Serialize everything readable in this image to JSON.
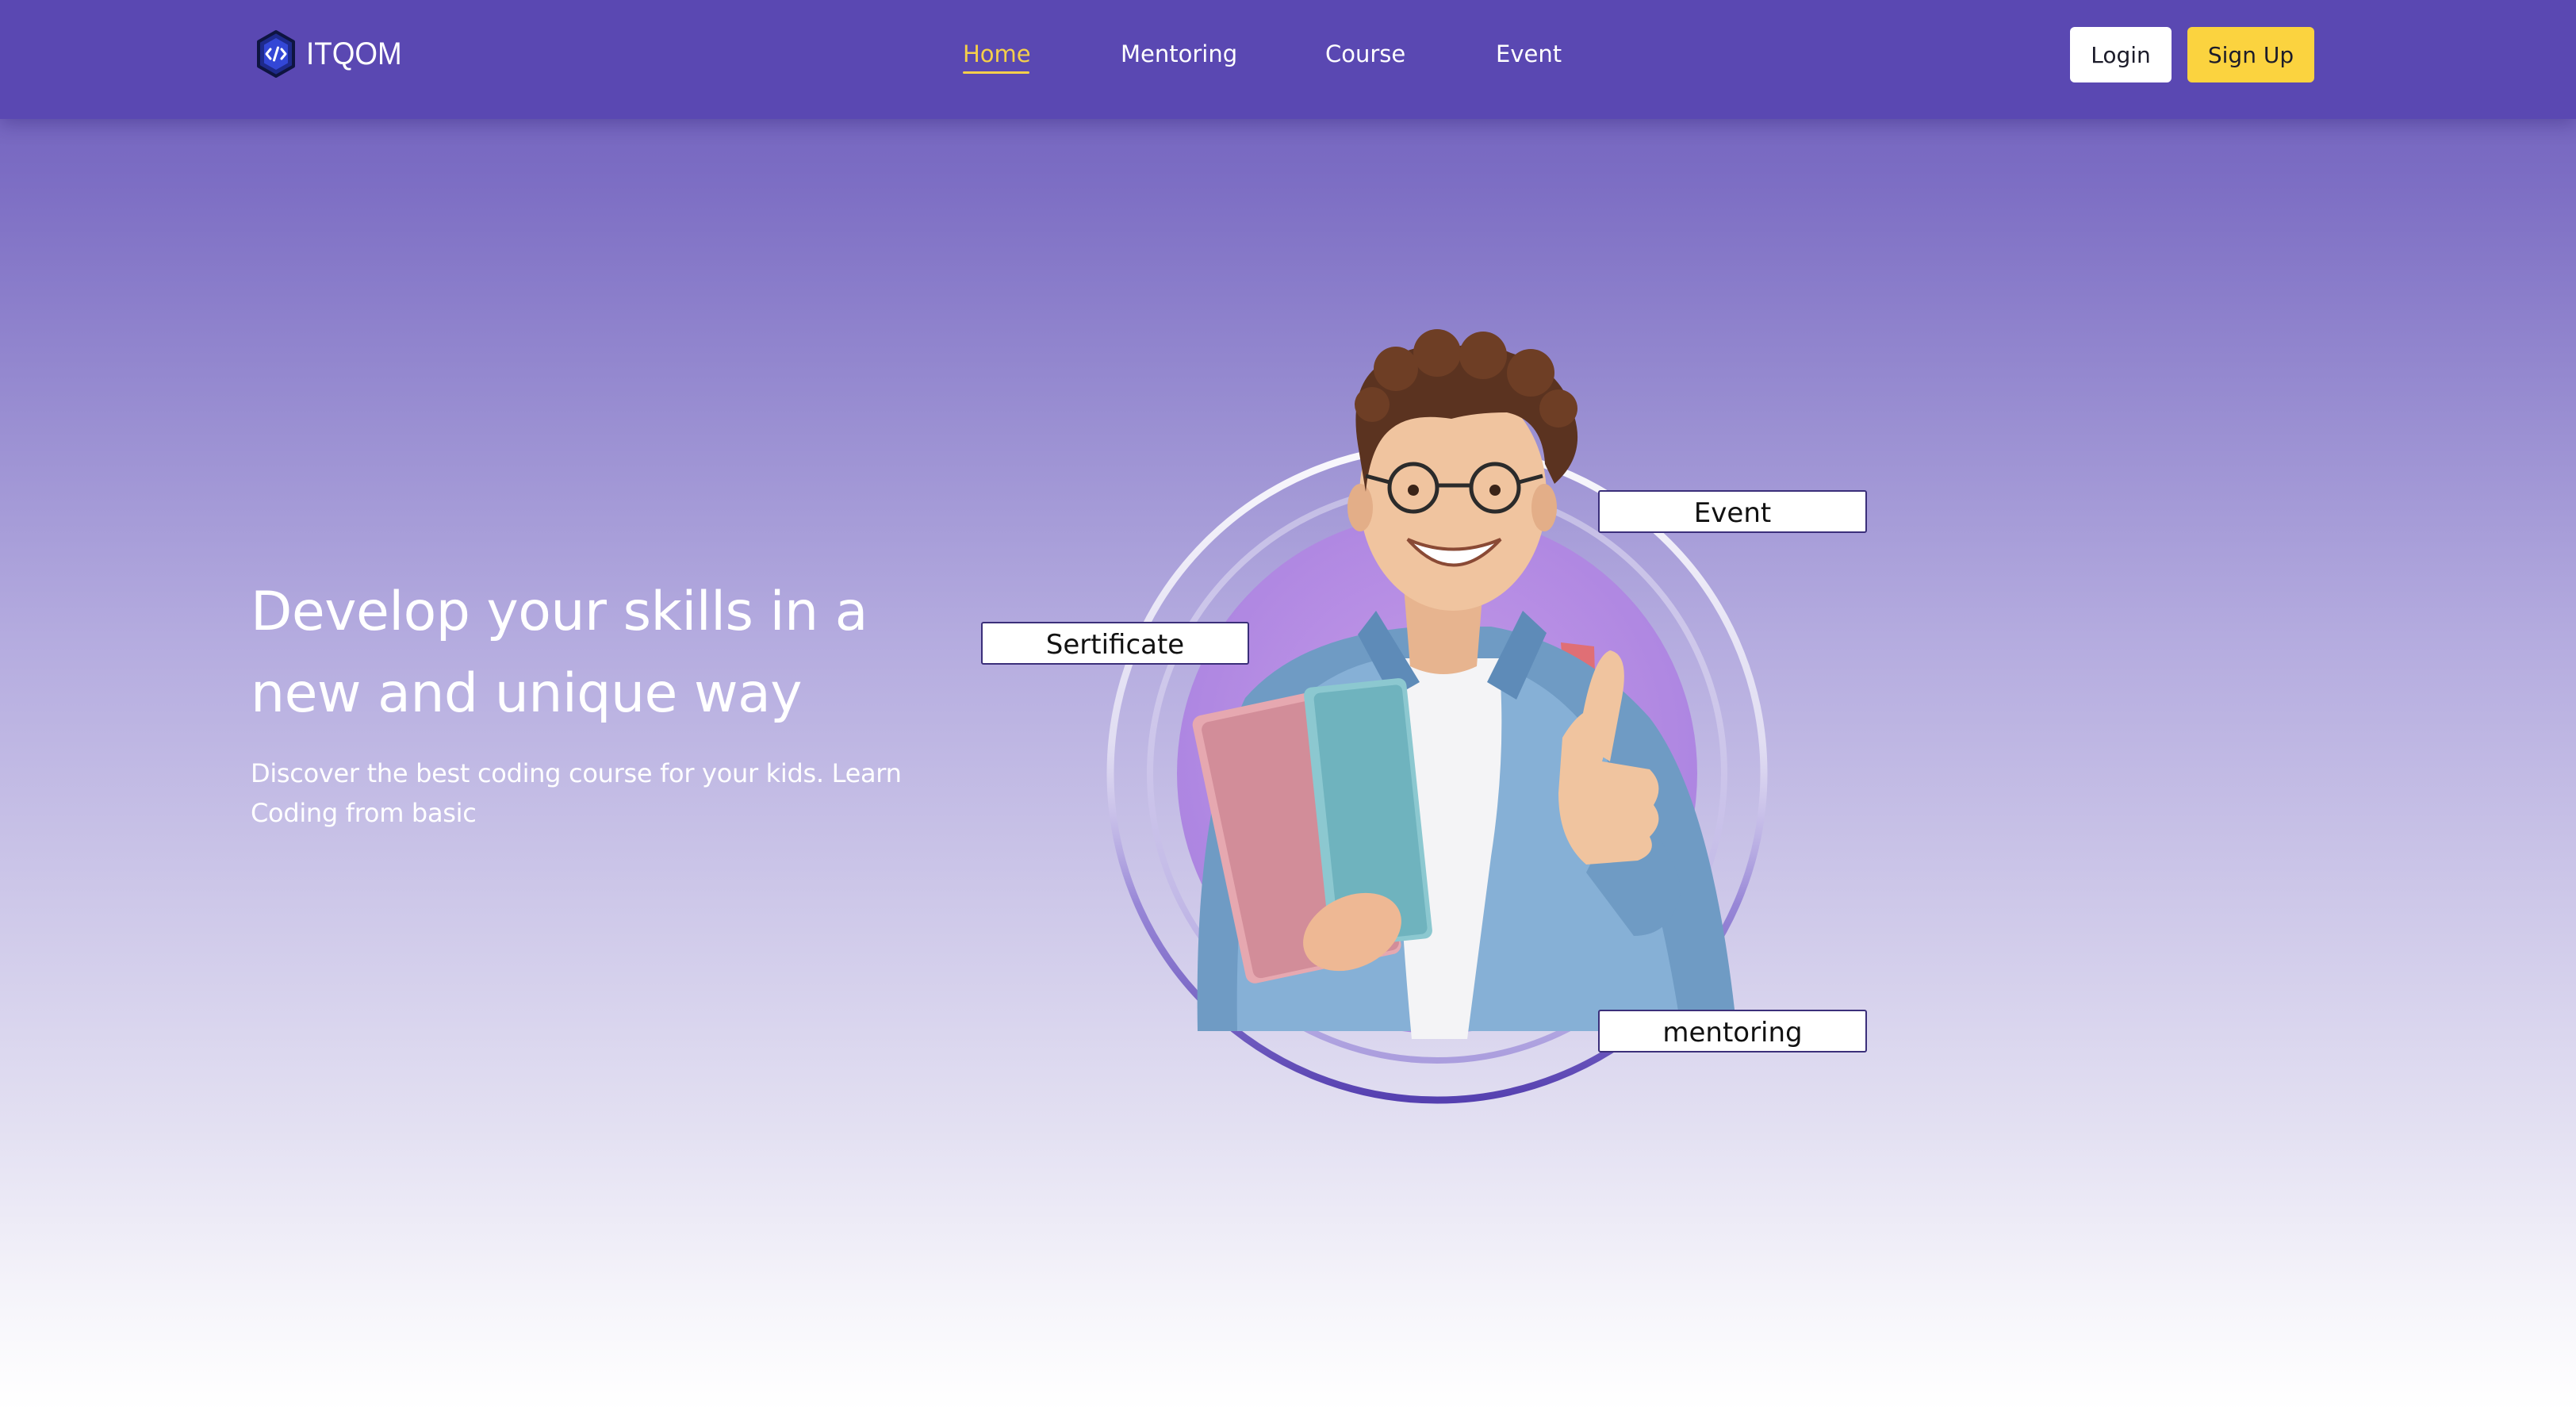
{
  "nav": {
    "brand": "ITQOM",
    "links": [
      {
        "label": "Home",
        "active": true
      },
      {
        "label": "Mentoring",
        "active": false
      },
      {
        "label": "Course",
        "active": false
      },
      {
        "label": "Event",
        "active": false
      }
    ],
    "login_label": "Login",
    "signup_label": "Sign Up"
  },
  "hero": {
    "title": "Develop your skills in a new and unique way",
    "subtitle": "Discover the best coding course for your kids. Learn Coding from basic"
  },
  "tags": {
    "event": "Event",
    "sertificate": "Sertificate",
    "mentoring": "mentoring"
  },
  "colors": {
    "nav_background": "#5a48b2",
    "active_link": "#f5cf4a",
    "signup_button": "#fbd33f",
    "login_button": "#ffffff",
    "hero_gradient_top": "#6a5ab8",
    "hero_gradient_bottom": "#ffffff",
    "ring_accent": "#5a48b2",
    "photo_circle": "#b48ee6"
  },
  "icons": {
    "brand_logo": "hexagon-code-icon",
    "hero_image": "student-thumbs-up-illustration"
  }
}
